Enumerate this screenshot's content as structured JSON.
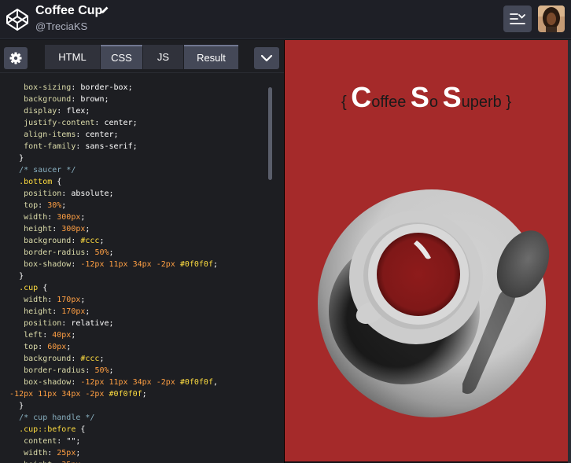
{
  "header": {
    "title": "Coffee Cup",
    "author": "@TreciaKS"
  },
  "editor": {
    "tabs": {
      "html": "HTML",
      "css": "CSS",
      "js": "JS",
      "result": "Result"
    }
  },
  "result": {
    "heading": {
      "open_brace": "{",
      "c_cap": "C",
      "c_rest": "offee",
      "s1_cap": "S",
      "s1_rest": "o",
      "s2_cap": "S",
      "s2_rest": "uperb",
      "close_brace": "}"
    }
  },
  "colors": {
    "result_bg": "#a52a2a",
    "saucer": "#cccccc",
    "coffee": "#8b1c1c"
  }
}
